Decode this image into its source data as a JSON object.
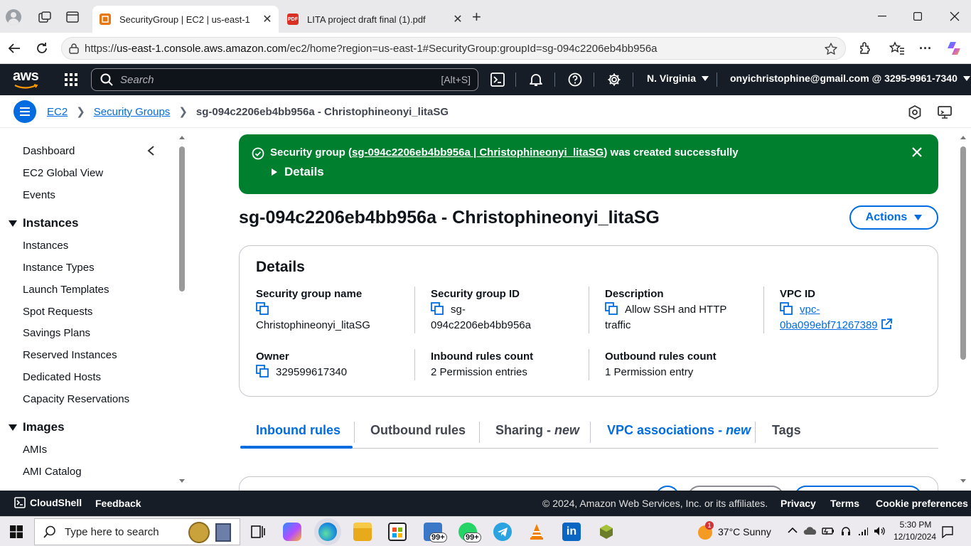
{
  "browser": {
    "tabs": [
      {
        "title": "SecurityGroup | EC2 | us-east-1",
        "active": true
      },
      {
        "title": "LITA project draft final (1).pdf",
        "active": false
      }
    ],
    "url_prefix": "https://",
    "url_host": "us-east-1.console.aws.amazon.com",
    "url_path": "/ec2/home?region=us-east-1#SecurityGroup:groupId=sg-094c2206eb4bb956a",
    "pdf_badge": "PDF"
  },
  "aws": {
    "logo": "aws",
    "search_placeholder": "Search",
    "search_shortcut": "[Alt+S]",
    "region": "N. Virginia",
    "account": "onyichristophine@gmail.com @ 3295-9961-7340"
  },
  "breadcrumb": {
    "root": "EC2",
    "section": "Security Groups",
    "current": "sg-094c2206eb4bb956a - Christophineonyi_litaSG"
  },
  "sidebar": {
    "top_items": [
      "Dashboard",
      "EC2 Global View",
      "Events"
    ],
    "groups": [
      {
        "title": "Instances",
        "items": [
          "Instances",
          "Instance Types",
          "Launch Templates",
          "Spot Requests",
          "Savings Plans",
          "Reserved Instances",
          "Dedicated Hosts",
          "Capacity Reservations"
        ]
      },
      {
        "title": "Images",
        "items": [
          "AMIs",
          "AMI Catalog"
        ]
      }
    ]
  },
  "flash": {
    "prefix": "Security group (",
    "link": "sg-094c2206eb4bb956a | Christophineonyi_litaSG",
    "suffix": ") was created successfully",
    "details": "Details"
  },
  "page": {
    "title": "sg-094c2206eb4bb956a - Christophineonyi_litaSG",
    "actions": "Actions"
  },
  "details": {
    "heading": "Details",
    "sg_name_label": "Security group name",
    "sg_name": "Christophineonyi_litaSG",
    "sg_id_label": "Security group ID",
    "sg_id_1": "sg-",
    "sg_id_2": "094c2206eb4bb956a",
    "desc_label": "Description",
    "desc_1": "Allow SSH and HTTP",
    "desc_2": "traffic",
    "vpc_label": "VPC ID",
    "vpc_1": "vpc-",
    "vpc_2": "0ba099ebf71267389",
    "owner_label": "Owner",
    "owner": "329599617340",
    "inbound_label": "Inbound rules count",
    "inbound": "2 Permission entries",
    "outbound_label": "Outbound rules count",
    "outbound": "1 Permission entry"
  },
  "tabs": {
    "inbound": "Inbound rules",
    "outbound": "Outbound rules",
    "sharing": "Sharing",
    "sharing_new": "new",
    "vpc_assoc": "VPC associations",
    "vpc_new": "new",
    "tags": "Tags",
    "dash": " - "
  },
  "footer": {
    "cloudshell": "CloudShell",
    "feedback": "Feedback",
    "copyright": "© 2024, Amazon Web Services, Inc. or its affiliates.",
    "privacy": "Privacy",
    "terms": "Terms",
    "cookies": "Cookie preferences"
  },
  "taskbar": {
    "search_placeholder": "Type here to search",
    "weather": "37°C  Sunny",
    "time": "5:30 PM",
    "date": "12/10/2024",
    "badge_mail": "99+",
    "badge_whatsapp": "99+",
    "weather_alert": "1"
  },
  "colors": {
    "flash_green": "#00802f",
    "link_blue": "#006ce0",
    "aws_navy": "#161d26"
  }
}
